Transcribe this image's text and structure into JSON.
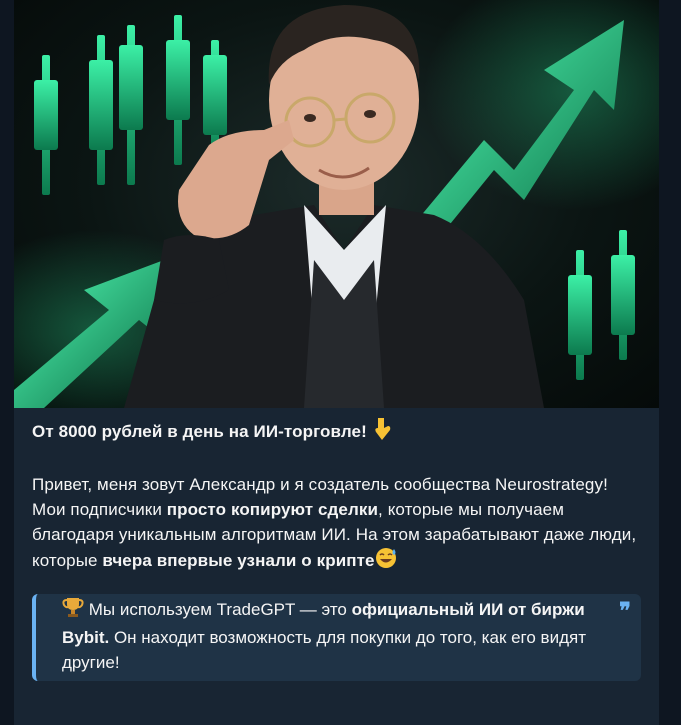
{
  "post": {
    "title": "От 8000 рублей в день на ИИ-торговле!",
    "title_emoji": "pointing-down-icon",
    "p1_part1": "Привет, меня зовут Александр и я создатель сообщества Neurostrategy! Мои подписчики ",
    "p1_bold1": "просто копируют сделки",
    "p1_part2": ", которые мы получаем благодаря уникальным алгоритмам ИИ. На этом зарабатывают даже люди, которые ",
    "p1_bold2": "вчера впервые узнали о крипте",
    "p1_emoji": "sweat-smile-icon",
    "quote_emoji": "trophy-icon",
    "quote_part1": " Мы используем TradeGPT — это ",
    "quote_bold": "официальный ИИ от биржи Bybit.",
    "quote_part2": " Он находит возможность для покупки до того, как его видят другие!",
    "quote_mark": "❞"
  },
  "colors": {
    "background": "#0e1621",
    "bubble": "#182533",
    "quote_bg": "#1f3346",
    "accent": "#6ab2f2",
    "green": "#1fd28a"
  }
}
